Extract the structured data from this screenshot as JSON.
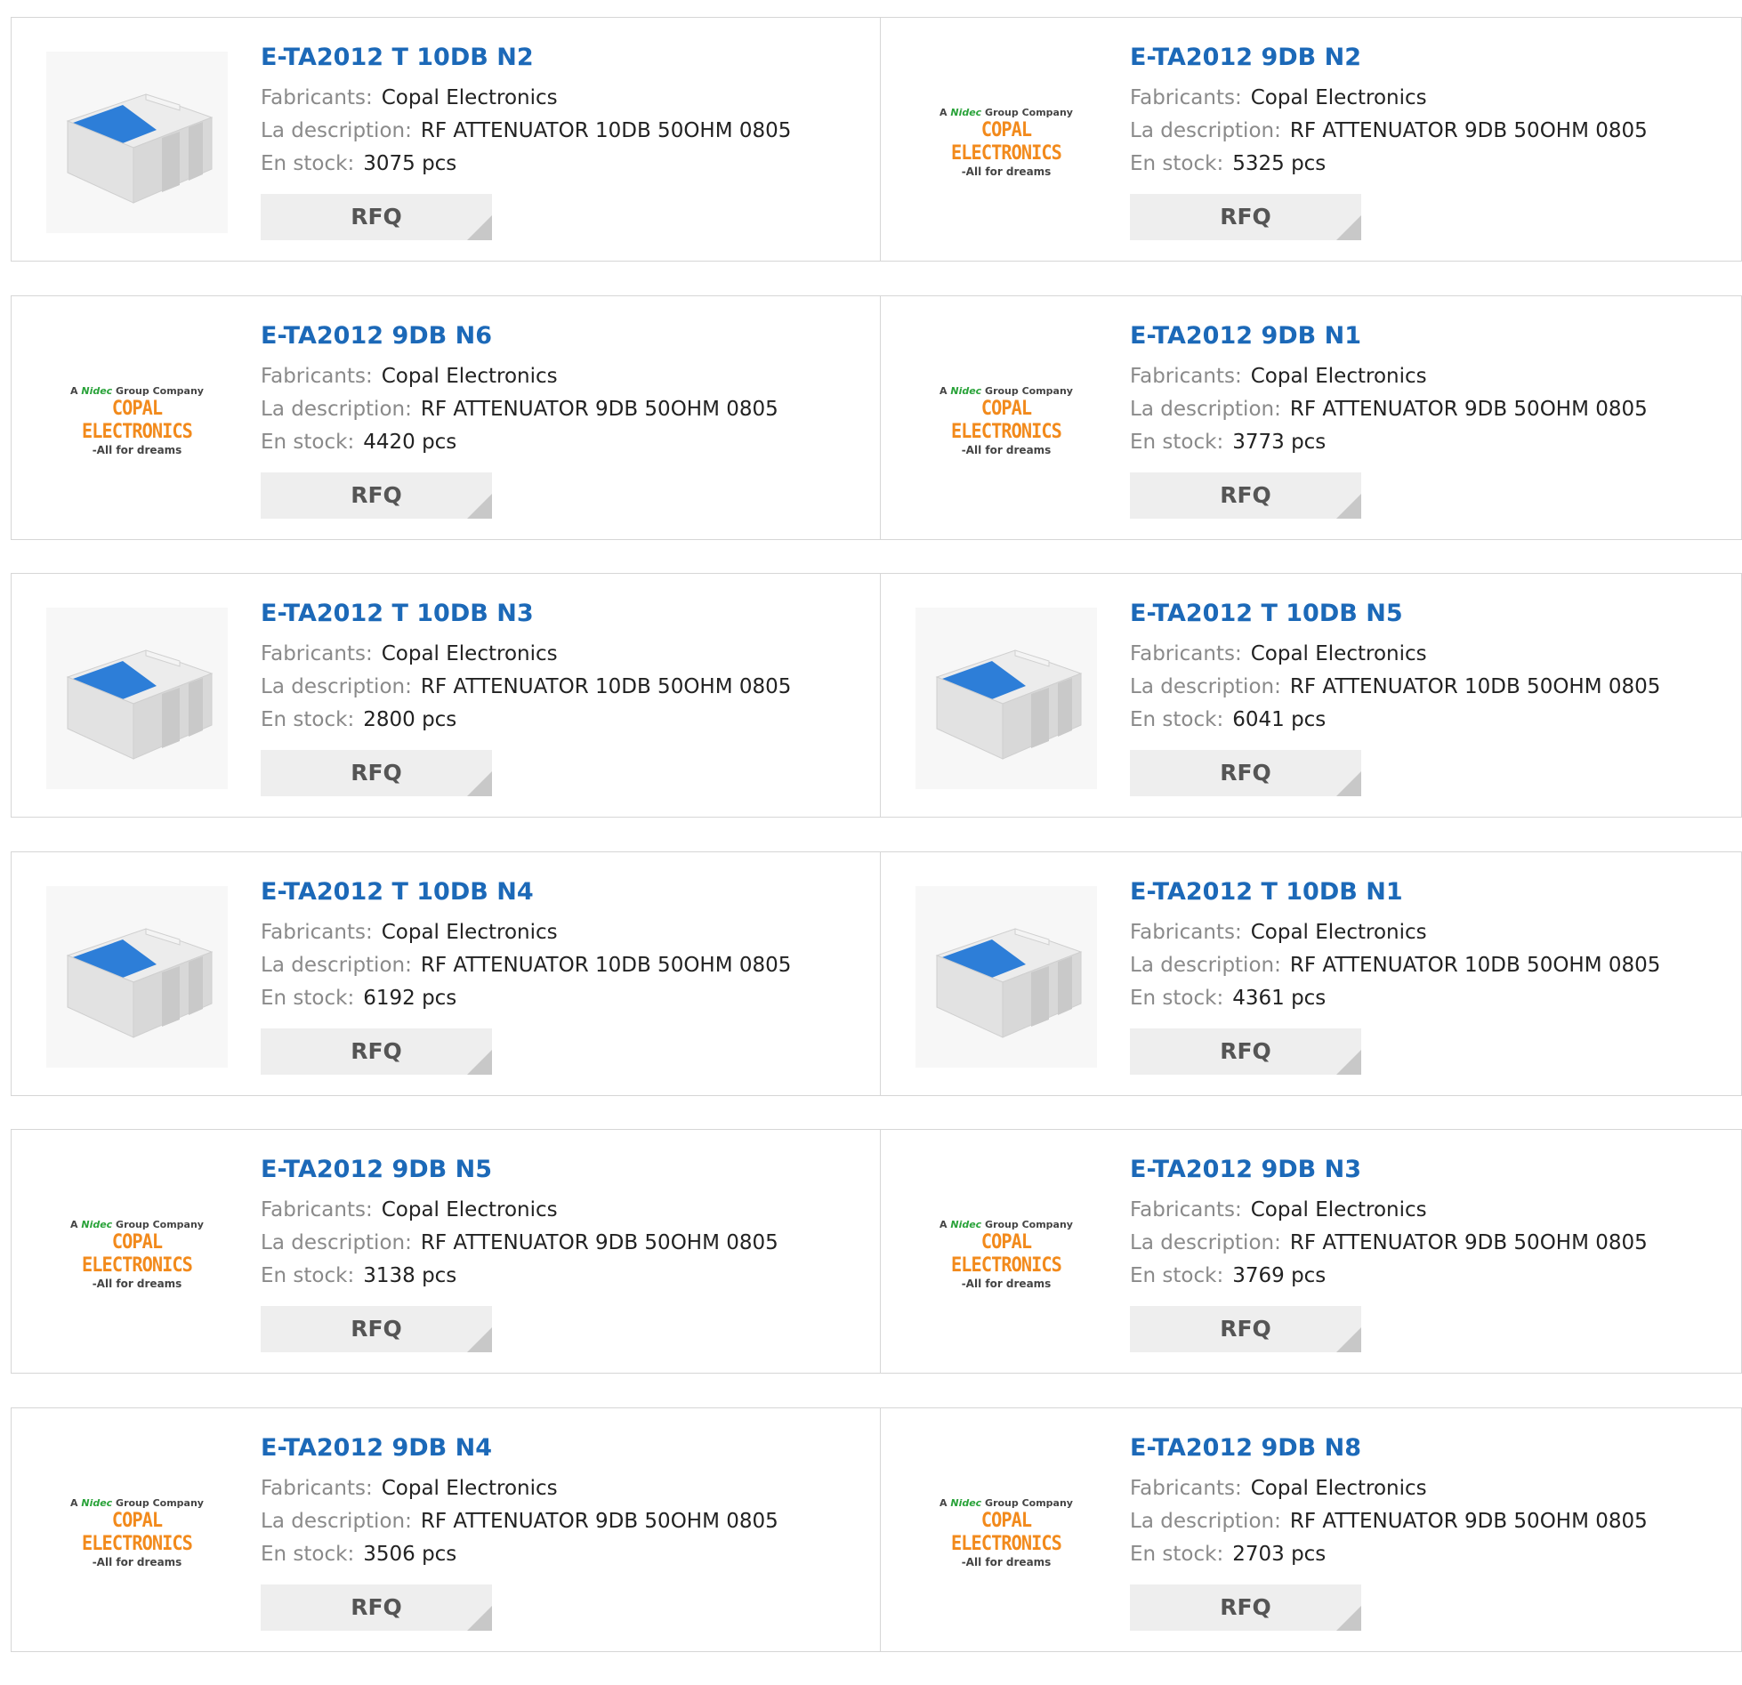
{
  "labels": {
    "manufacturer": "Fabricants:",
    "description": "La description:",
    "stock": "En stock:",
    "rfq": "RFQ"
  },
  "logo": {
    "tagline_prefix": "A",
    "brand": "Nidec",
    "tagline_suffix": "Group Company",
    "name": "COPAL ELECTRONICS",
    "slogan": "-All for dreams"
  },
  "colors": {
    "link": "#1c69b8",
    "logo_orange": "#f28a1c",
    "chip_blue": "#2d7ed8"
  },
  "products": [
    {
      "part": "E-TA2012 T 10DB N2",
      "manufacturer": "Copal Electronics",
      "description": "RF ATTENUATOR 10DB 50OHM 0805",
      "stock": "3075 pcs",
      "image": "chip"
    },
    {
      "part": "E-TA2012 9DB N2",
      "manufacturer": "Copal Electronics",
      "description": "RF ATTENUATOR 9DB 50OHM 0805",
      "stock": "5325 pcs",
      "image": "logo"
    },
    {
      "part": "E-TA2012 9DB N6",
      "manufacturer": "Copal Electronics",
      "description": "RF ATTENUATOR 9DB 50OHM 0805",
      "stock": "4420 pcs",
      "image": "logo"
    },
    {
      "part": "E-TA2012 9DB N1",
      "manufacturer": "Copal Electronics",
      "description": "RF ATTENUATOR 9DB 50OHM 0805",
      "stock": "3773 pcs",
      "image": "logo"
    },
    {
      "part": "E-TA2012 T 10DB N3",
      "manufacturer": "Copal Electronics",
      "description": "RF ATTENUATOR 10DB 50OHM 0805",
      "stock": "2800 pcs",
      "image": "chip"
    },
    {
      "part": "E-TA2012 T 10DB N5",
      "manufacturer": "Copal Electronics",
      "description": "RF ATTENUATOR 10DB 50OHM 0805",
      "stock": "6041 pcs",
      "image": "chip"
    },
    {
      "part": "E-TA2012 T 10DB N4",
      "manufacturer": "Copal Electronics",
      "description": "RF ATTENUATOR 10DB 50OHM 0805",
      "stock": "6192 pcs",
      "image": "chip"
    },
    {
      "part": "E-TA2012 T 10DB N1",
      "manufacturer": "Copal Electronics",
      "description": "RF ATTENUATOR 10DB 50OHM 0805",
      "stock": "4361 pcs",
      "image": "chip"
    },
    {
      "part": "E-TA2012 9DB N5",
      "manufacturer": "Copal Electronics",
      "description": "RF ATTENUATOR 9DB 50OHM 0805",
      "stock": "3138 pcs",
      "image": "logo"
    },
    {
      "part": "E-TA2012 9DB N3",
      "manufacturer": "Copal Electronics",
      "description": "RF ATTENUATOR 9DB 50OHM 0805",
      "stock": "3769 pcs",
      "image": "logo"
    },
    {
      "part": "E-TA2012 9DB N4",
      "manufacturer": "Copal Electronics",
      "description": "RF ATTENUATOR 9DB 50OHM 0805",
      "stock": "3506 pcs",
      "image": "logo"
    },
    {
      "part": "E-TA2012 9DB N8",
      "manufacturer": "Copal Electronics",
      "description": "RF ATTENUATOR 9DB 50OHM 0805",
      "stock": "2703 pcs",
      "image": "logo"
    }
  ]
}
